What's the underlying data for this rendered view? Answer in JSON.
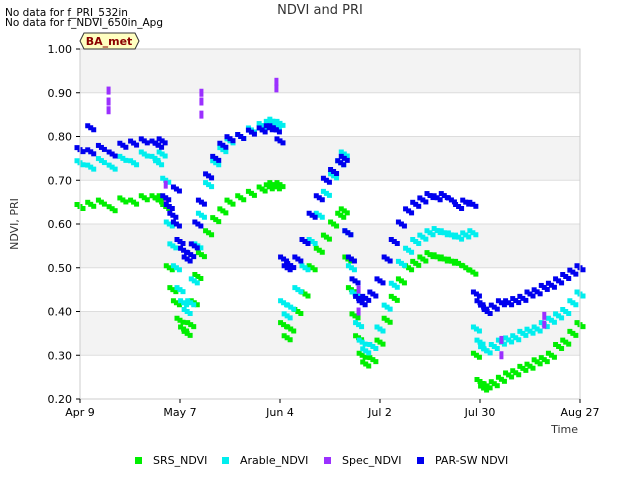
{
  "notes": [
    "No data for f_PRI_532in",
    "No data for f_NDVI_650in_Apg"
  ],
  "site_label": "BA_met",
  "chart_data": {
    "type": "scatter",
    "title": "NDVI and PRI",
    "xlabel": "Time",
    "ylabel": "NDVI, PRI",
    "xlim": [
      "2024-04-09",
      "2024-08-27"
    ],
    "ylim": [
      0.2,
      1.0
    ],
    "y_ticks": [
      "0.20",
      "0.30",
      "0.40",
      "0.50",
      "0.60",
      "0.70",
      "0.80",
      "0.90",
      "1.00"
    ],
    "x_ticks": [
      "Apr 9",
      "May 7",
      "Jun 4",
      "Jul 2",
      "Jul 30",
      "Aug 27"
    ],
    "grid": "horizontal",
    "legend_placement": "bottom",
    "series": [
      {
        "name": "SRS_NDVI",
        "color": "#00ee00",
        "x": [
          "2024-04-09",
          "2024-04-12",
          "2024-04-15",
          "2024-04-18",
          "2024-04-21",
          "2024-04-24",
          "2024-04-27",
          "2024-04-30",
          "2024-05-01",
          "2024-05-02",
          "2024-05-03",
          "2024-05-04",
          "2024-05-05",
          "2024-05-06",
          "2024-05-07",
          "2024-05-08",
          "2024-05-09",
          "2024-05-10",
          "2024-05-11",
          "2024-05-12",
          "2024-05-13",
          "2024-05-15",
          "2024-05-17",
          "2024-05-19",
          "2024-05-21",
          "2024-05-24",
          "2024-05-27",
          "2024-05-30",
          "2024-06-01",
          "2024-06-02",
          "2024-06-03",
          "2024-06-04",
          "2024-06-05",
          "2024-06-06",
          "2024-06-07",
          "2024-06-09",
          "2024-06-11",
          "2024-06-13",
          "2024-06-15",
          "2024-06-17",
          "2024-06-19",
          "2024-06-21",
          "2024-06-22",
          "2024-06-23",
          "2024-06-24",
          "2024-06-25",
          "2024-06-26",
          "2024-06-27",
          "2024-06-28",
          "2024-06-30",
          "2024-07-02",
          "2024-07-04",
          "2024-07-06",
          "2024-07-08",
          "2024-07-10",
          "2024-07-12",
          "2024-07-14",
          "2024-07-16",
          "2024-07-18",
          "2024-07-20",
          "2024-07-22",
          "2024-07-24",
          "2024-07-26",
          "2024-07-28",
          "2024-07-29",
          "2024-07-30",
          "2024-07-31",
          "2024-08-01",
          "2024-08-03",
          "2024-08-05",
          "2024-08-07",
          "2024-08-09",
          "2024-08-11",
          "2024-08-13",
          "2024-08-15",
          "2024-08-17",
          "2024-08-19",
          "2024-08-21",
          "2024-08-23",
          "2024-08-25",
          "2024-08-27"
        ],
        "y": [
          0.64,
          0.645,
          0.65,
          0.635,
          0.655,
          0.65,
          0.66,
          0.66,
          0.655,
          0.66,
          0.64,
          0.5,
          0.45,
          0.42,
          0.38,
          0.36,
          0.35,
          0.37,
          0.42,
          0.48,
          0.53,
          0.58,
          0.61,
          0.63,
          0.65,
          0.66,
          0.67,
          0.68,
          0.685,
          0.69,
          0.685,
          0.69,
          0.37,
          0.34,
          0.36,
          0.4,
          0.44,
          0.5,
          0.54,
          0.57,
          0.6,
          0.62,
          0.63,
          0.52,
          0.45,
          0.39,
          0.34,
          0.3,
          0.28,
          0.29,
          0.33,
          0.38,
          0.43,
          0.47,
          0.5,
          0.51,
          0.52,
          0.53,
          0.525,
          0.52,
          0.515,
          0.51,
          0.5,
          0.49,
          0.3,
          0.24,
          0.225,
          0.23,
          0.235,
          0.245,
          0.255,
          0.26,
          0.27,
          0.275,
          0.285,
          0.29,
          0.3,
          0.32,
          0.33,
          0.35,
          0.37
        ]
      },
      {
        "name": "Arable_NDVI",
        "color": "#00eeee",
        "x": [
          "2024-04-09",
          "2024-04-12",
          "2024-04-15",
          "2024-04-18",
          "2024-04-21",
          "2024-04-24",
          "2024-04-27",
          "2024-04-30",
          "2024-05-01",
          "2024-05-02",
          "2024-05-03",
          "2024-05-04",
          "2024-05-05",
          "2024-05-06",
          "2024-05-07",
          "2024-05-08",
          "2024-05-09",
          "2024-05-10",
          "2024-05-11",
          "2024-05-12",
          "2024-05-13",
          "2024-05-15",
          "2024-05-17",
          "2024-05-19",
          "2024-05-21",
          "2024-05-24",
          "2024-05-27",
          "2024-05-30",
          "2024-06-01",
          "2024-06-02",
          "2024-06-03",
          "2024-06-04",
          "2024-06-05",
          "2024-06-06",
          "2024-06-07",
          "2024-06-09",
          "2024-06-11",
          "2024-06-13",
          "2024-06-15",
          "2024-06-17",
          "2024-06-19",
          "2024-06-21",
          "2024-06-22",
          "2024-06-23",
          "2024-06-24",
          "2024-06-25",
          "2024-06-26",
          "2024-06-27",
          "2024-06-28",
          "2024-06-30",
          "2024-07-02",
          "2024-07-04",
          "2024-07-06",
          "2024-07-08",
          "2024-07-10",
          "2024-07-12",
          "2024-07-14",
          "2024-07-16",
          "2024-07-18",
          "2024-07-20",
          "2024-07-22",
          "2024-07-24",
          "2024-07-26",
          "2024-07-28",
          "2024-07-29",
          "2024-07-30",
          "2024-07-31",
          "2024-08-01",
          "2024-08-03",
          "2024-08-05",
          "2024-08-07",
          "2024-08-09",
          "2024-08-11",
          "2024-08-13",
          "2024-08-15",
          "2024-08-17",
          "2024-08-19",
          "2024-08-21",
          "2024-08-23",
          "2024-08-25",
          "2024-08-27"
        ],
        "y": [
          0.74,
          0.73,
          0.745,
          0.73,
          0.75,
          0.74,
          0.76,
          0.75,
          0.74,
          0.76,
          0.7,
          0.6,
          0.55,
          0.5,
          0.45,
          0.42,
          0.4,
          0.42,
          0.47,
          0.55,
          0.62,
          0.69,
          0.74,
          0.77,
          0.79,
          0.8,
          0.815,
          0.825,
          0.83,
          0.835,
          0.825,
          0.83,
          0.42,
          0.39,
          0.41,
          0.45,
          0.5,
          0.56,
          0.62,
          0.67,
          0.71,
          0.74,
          0.76,
          0.58,
          0.5,
          0.44,
          0.37,
          0.33,
          0.31,
          0.32,
          0.36,
          0.41,
          0.46,
          0.51,
          0.54,
          0.56,
          0.57,
          0.58,
          0.585,
          0.58,
          0.575,
          0.57,
          0.575,
          0.58,
          0.36,
          0.33,
          0.315,
          0.31,
          0.32,
          0.33,
          0.335,
          0.34,
          0.35,
          0.355,
          0.36,
          0.37,
          0.38,
          0.39,
          0.4,
          0.42,
          0.44
        ]
      },
      {
        "name": "Spec_NDVI",
        "color": "#9b30ff",
        "x": [
          "2024-04-17",
          "2024-04-17",
          "2024-04-17",
          "2024-05-03",
          "2024-05-03",
          "2024-05-13",
          "2024-05-13",
          "2024-05-13",
          "2024-06-03",
          "2024-06-03",
          "2024-06-26",
          "2024-06-26",
          "2024-08-05",
          "2024-08-05",
          "2024-08-17",
          "2024-08-17"
        ],
        "y": [
          0.905,
          0.88,
          0.86,
          0.69,
          0.655,
          0.9,
          0.88,
          0.85,
          0.925,
          0.91,
          0.45,
          0.4,
          0.335,
          0.3,
          0.39,
          0.37
        ]
      },
      {
        "name": "PAR-SW NDVI",
        "color": "#0000ee",
        "x": [
          "2024-04-09",
          "2024-04-12",
          "2024-04-15",
          "2024-04-18",
          "2024-04-21",
          "2024-04-24",
          "2024-04-27",
          "2024-04-30",
          "2024-05-01",
          "2024-05-02",
          "2024-05-03",
          "2024-05-04",
          "2024-05-05",
          "2024-05-06",
          "2024-05-07",
          "2024-05-08",
          "2024-05-09",
          "2024-05-10",
          "2024-05-11",
          "2024-05-12",
          "2024-05-13",
          "2024-05-15",
          "2024-05-17",
          "2024-05-19",
          "2024-05-21",
          "2024-05-24",
          "2024-05-27",
          "2024-05-30",
          "2024-06-01",
          "2024-06-02",
          "2024-06-03",
          "2024-06-04",
          "2024-06-05",
          "2024-06-06",
          "2024-06-07",
          "2024-06-09",
          "2024-06-11",
          "2024-06-13",
          "2024-06-15",
          "2024-06-17",
          "2024-06-19",
          "2024-06-21",
          "2024-06-22",
          "2024-06-23",
          "2024-06-24",
          "2024-06-25",
          "2024-06-26",
          "2024-06-27",
          "2024-06-28",
          "2024-06-30",
          "2024-07-02",
          "2024-07-04",
          "2024-07-06",
          "2024-07-08",
          "2024-07-10",
          "2024-07-12",
          "2024-07-14",
          "2024-07-16",
          "2024-07-18",
          "2024-07-20",
          "2024-07-22",
          "2024-07-24",
          "2024-07-26",
          "2024-07-28",
          "2024-07-29",
          "2024-07-30",
          "2024-07-31",
          "2024-08-01",
          "2024-08-03",
          "2024-08-05",
          "2024-08-07",
          "2024-08-09",
          "2024-08-11",
          "2024-08-13",
          "2024-08-15",
          "2024-08-17",
          "2024-08-19",
          "2024-08-21",
          "2024-08-23",
          "2024-08-25",
          "2024-08-27",
          "2024-04-12",
          "2024-05-06"
        ],
        "y": [
          0.77,
          0.765,
          0.775,
          0.76,
          0.78,
          0.785,
          0.79,
          0.785,
          0.78,
          0.79,
          0.66,
          0.64,
          0.62,
          0.6,
          0.56,
          0.54,
          0.52,
          0.53,
          0.55,
          0.6,
          0.65,
          0.71,
          0.75,
          0.78,
          0.795,
          0.8,
          0.81,
          0.815,
          0.82,
          0.82,
          0.815,
          0.79,
          0.52,
          0.5,
          0.505,
          0.52,
          0.56,
          0.62,
          0.66,
          0.7,
          0.72,
          0.74,
          0.75,
          0.58,
          0.52,
          0.47,
          0.43,
          0.42,
          0.43,
          0.44,
          0.47,
          0.52,
          0.56,
          0.6,
          0.63,
          0.645,
          0.655,
          0.665,
          0.66,
          0.665,
          0.655,
          0.64,
          0.65,
          0.645,
          0.44,
          0.42,
          0.41,
          0.4,
          0.41,
          0.42,
          0.42,
          0.425,
          0.43,
          0.44,
          0.445,
          0.455,
          0.46,
          0.47,
          0.48,
          0.49,
          0.5,
          0.82,
          0.68
        ]
      }
    ]
  }
}
